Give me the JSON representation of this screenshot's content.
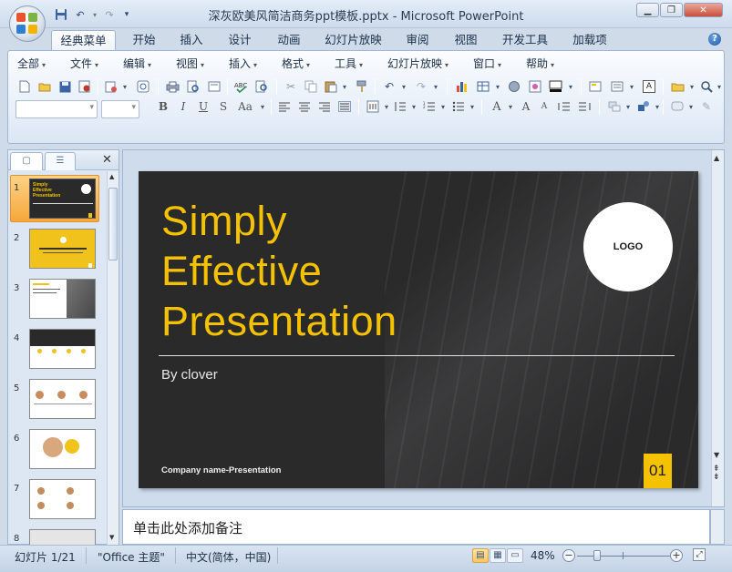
{
  "window": {
    "title": "深灰欧美风简洁商务ppt模板.pptx - Microsoft PowerPoint",
    "controls": [
      "minimize",
      "maximize",
      "close"
    ]
  },
  "quick_access": [
    "save-icon",
    "undo-icon",
    "redo-icon",
    "customize-icon"
  ],
  "tabs": [
    {
      "label": "经典菜单",
      "active": true
    },
    {
      "label": "开始"
    },
    {
      "label": "插入"
    },
    {
      "label": "设计"
    },
    {
      "label": "动画"
    },
    {
      "label": "幻灯片放映"
    },
    {
      "label": "审阅"
    },
    {
      "label": "视图"
    },
    {
      "label": "开发工具"
    },
    {
      "label": "加载项"
    }
  ],
  "menus": [
    {
      "label": "全部"
    },
    {
      "label": "文件"
    },
    {
      "label": "编辑"
    },
    {
      "label": "视图"
    },
    {
      "label": "插入"
    },
    {
      "label": "格式"
    },
    {
      "label": "工具"
    },
    {
      "label": "幻灯片放映"
    },
    {
      "label": "窗口"
    },
    {
      "label": "帮助"
    }
  ],
  "toolbar": {
    "bold": "B",
    "italic": "I",
    "underline": "U",
    "shadow": "S",
    "change_case": "Aa",
    "grow_font": "A",
    "shrink_font": "A",
    "textbox": "A"
  },
  "slide_panel": {
    "thumbnails": [
      {
        "num": "1",
        "selected": true,
        "lines": [
          "Simply",
          "Effective",
          "Presentation"
        ]
      },
      {
        "num": "2"
      },
      {
        "num": "3"
      },
      {
        "num": "4"
      },
      {
        "num": "5"
      },
      {
        "num": "6"
      },
      {
        "num": "7"
      },
      {
        "num": "8"
      }
    ]
  },
  "slide": {
    "title_lines": [
      "Simply",
      "Effective",
      "Presentation"
    ],
    "byline": "By clover",
    "logo": "LOGO",
    "company": "Company name-Presentation",
    "page_number": "01",
    "colors": {
      "background": "#2a2a2b",
      "accent": "#f5c200",
      "text": "#ffffff"
    }
  },
  "notes": {
    "placeholder": "单击此处添加备注"
  },
  "status": {
    "slide": "幻灯片 1/21",
    "theme": "\"Office 主题\"",
    "language": "中文(简体，中国)",
    "zoom": "48%",
    "zoom_level": 0.48
  }
}
